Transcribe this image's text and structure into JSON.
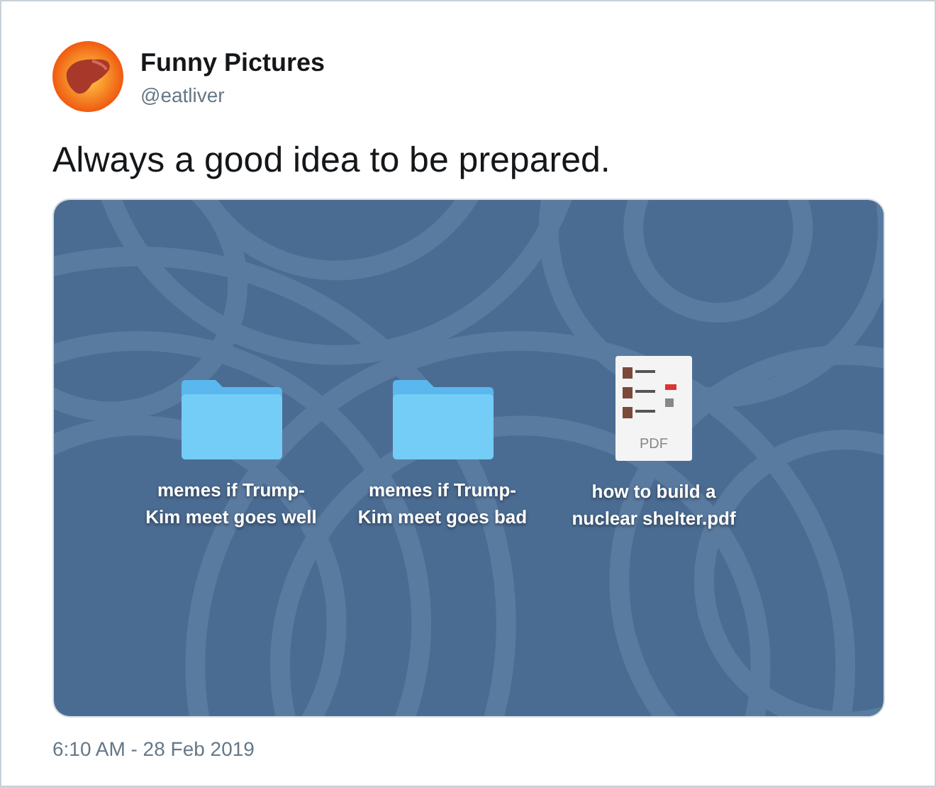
{
  "author": {
    "name": "Funny Pictures",
    "handle": "@eatliver"
  },
  "text": "Always a good idea to be prepared.",
  "desktop": {
    "files": [
      {
        "kind": "folder",
        "label": "memes if Trump-Kim meet goes well"
      },
      {
        "kind": "folder",
        "label": "memes if Trump-Kim meet goes bad"
      },
      {
        "kind": "pdf",
        "label": "how to build a nuclear shelter.pdf",
        "badge": "PDF"
      }
    ]
  },
  "timestamp": "6:10 AM - 28 Feb 2019"
}
